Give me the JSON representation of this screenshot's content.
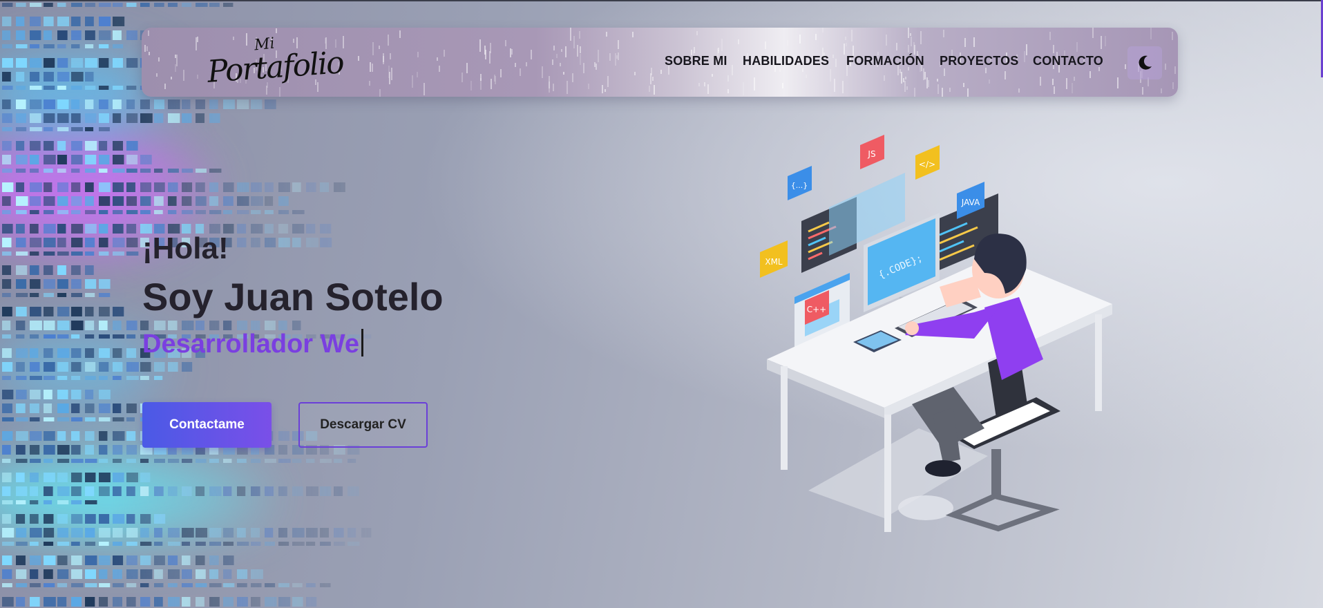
{
  "navbar": {
    "logo": {
      "prefix": "Mi",
      "main": "Portafolio"
    },
    "links": [
      {
        "label": "SOBRE MI"
      },
      {
        "label": "HABILIDADES"
      },
      {
        "label": "FORMACIÓN"
      },
      {
        "label": "PROYECTOS"
      },
      {
        "label": "CONTACTO"
      }
    ],
    "theme_toggle_icon": "moon-icon"
  },
  "hero": {
    "greeting": "¡Hola!",
    "name": "Soy Juan Sotelo",
    "role_typed": "Desarrollador We",
    "buttons": {
      "contact_label": "Contactame",
      "download_label": "Descargar CV"
    },
    "illustration": {
      "badges": [
        "{...}",
        "JS",
        "</>",
        "XML",
        "JAVA",
        "C++"
      ],
      "monitor_text": "{.CODE};"
    }
  },
  "colors": {
    "accent_purple": "#7a3fe0",
    "button_gradient_start": "#4a5ae6",
    "button_gradient_end": "#7a4fe8",
    "text_dark": "#25222d"
  }
}
